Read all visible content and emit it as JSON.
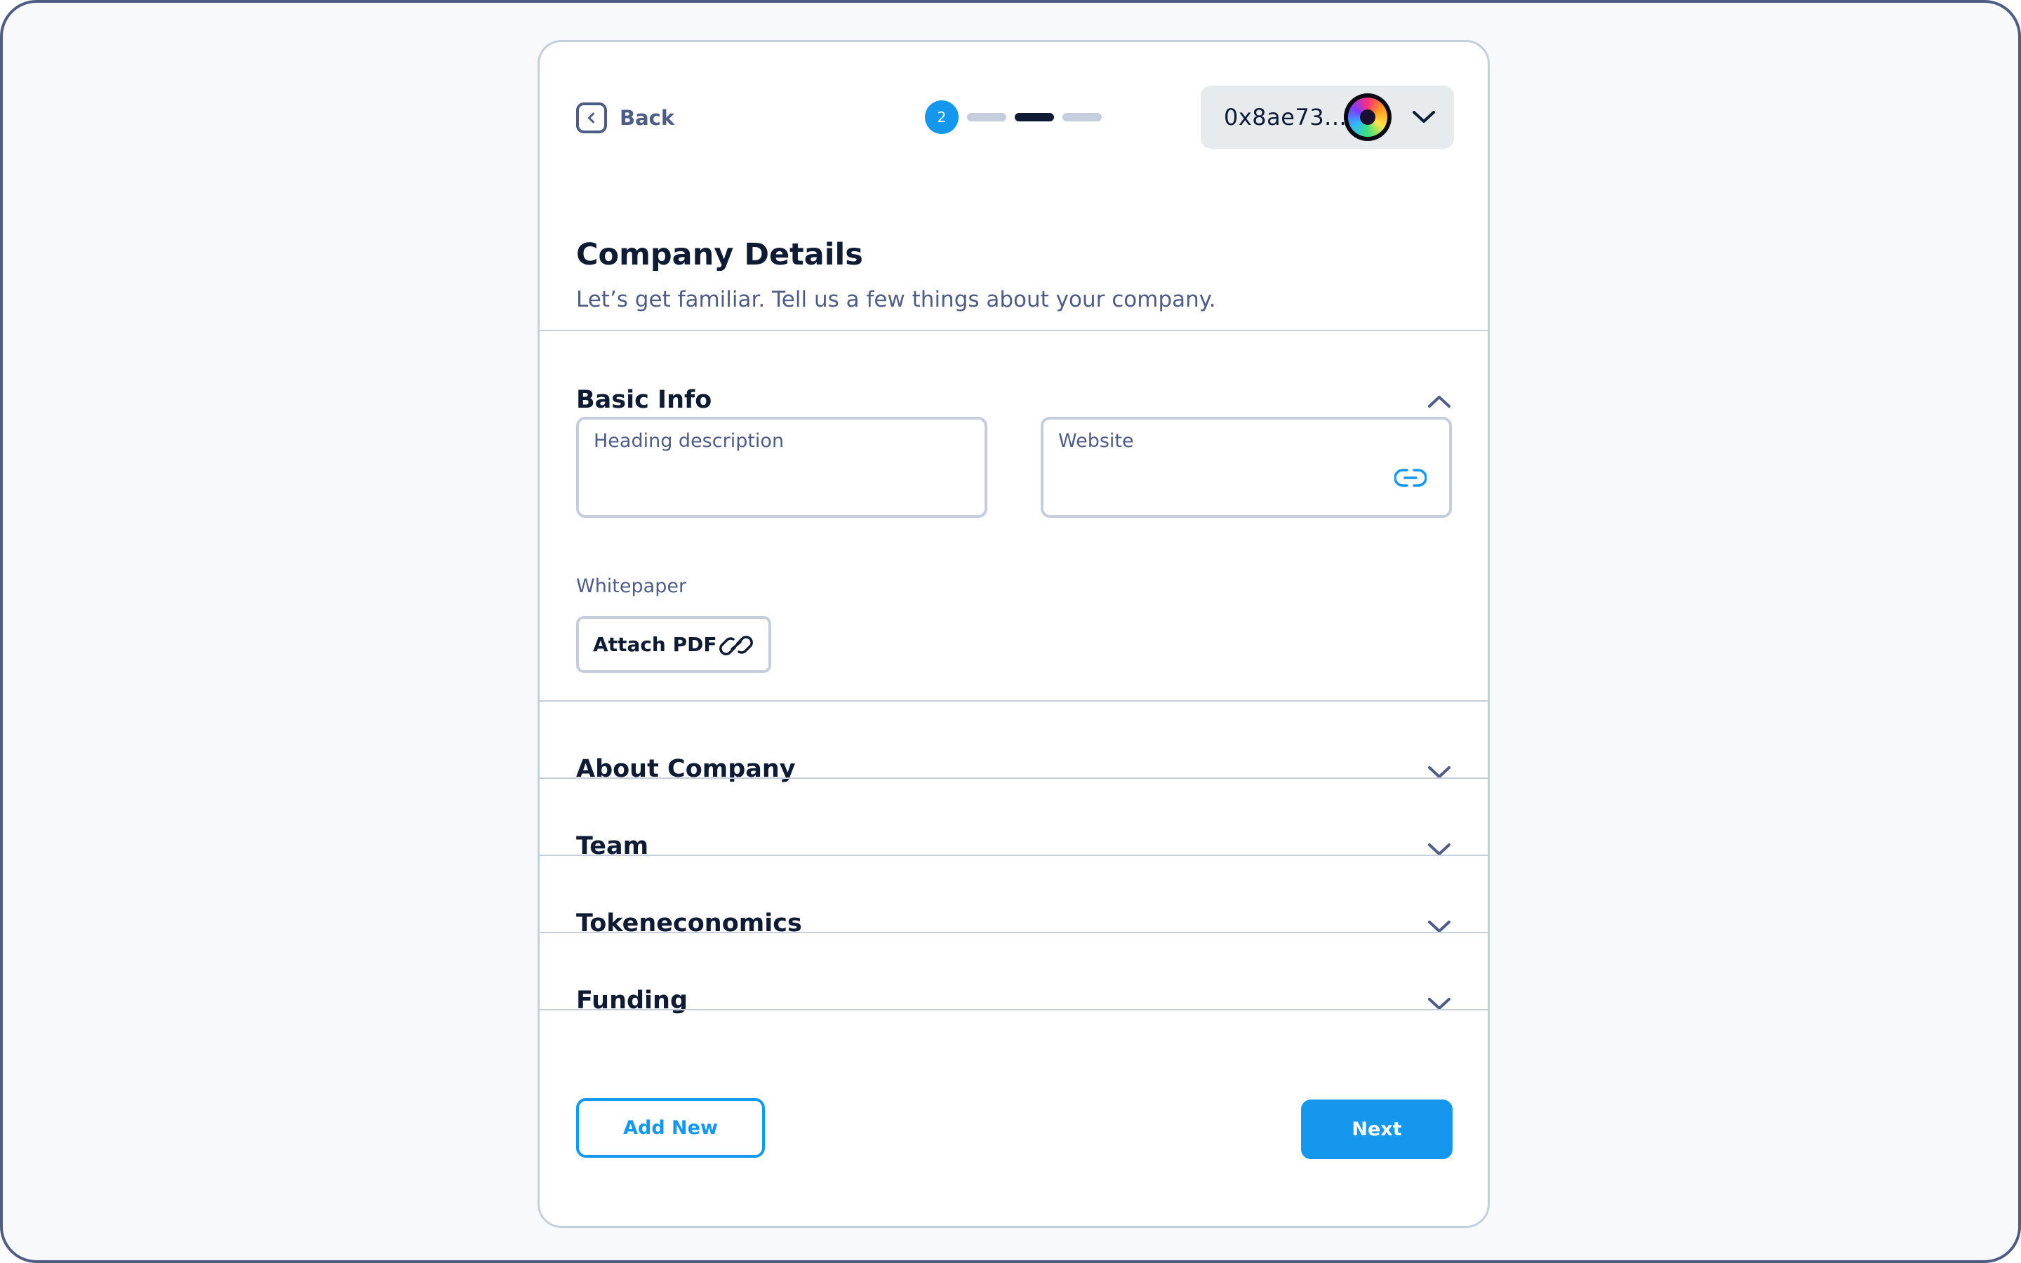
{
  "header": {
    "back_label": "Back",
    "current_step": "2",
    "wallet_address": "0x8ae73..."
  },
  "page": {
    "title": "Company Details",
    "subtitle": "Let’s get familiar. Tell us a few things about your company."
  },
  "sections": {
    "basic_info": {
      "title": "Basic Info",
      "expanded": true,
      "heading_field_label": "Heading description",
      "website_field_label": "Website",
      "whitepaper_label": "Whitepaper",
      "attach_label": "Attach PDF"
    },
    "about_company": {
      "title": "About Company"
    },
    "team": {
      "title": "Team"
    },
    "tokeneconomics": {
      "title": "Tokeneconomics"
    },
    "funding": {
      "title": "Funding"
    }
  },
  "footer": {
    "add_new_label": "Add New",
    "next_label": "Next"
  },
  "colors": {
    "primary": "#1597ee",
    "text_dark": "#0f1a33",
    "text_muted": "#4f5d84",
    "border": "#c6cede",
    "wallet_bg": "#e8ebee"
  },
  "icons": {
    "back": "chevron-left-icon",
    "wallet_dropdown": "chevron-down-icon",
    "section_expanded": "chevron-up-icon",
    "section_collapsed": "chevron-down-icon",
    "website": "link-icon",
    "attach": "paperclip-link-icon"
  }
}
